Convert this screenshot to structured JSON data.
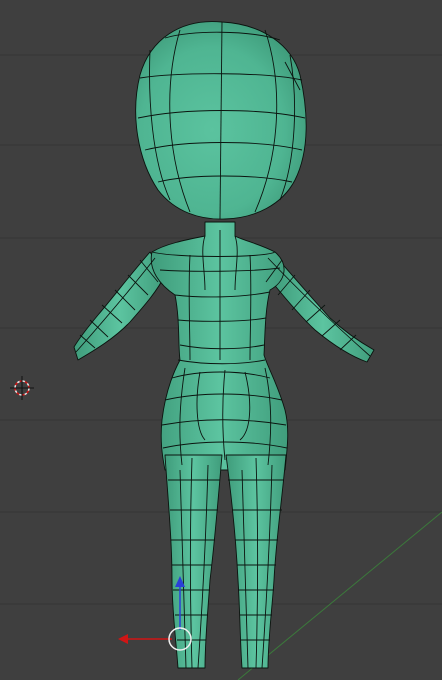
{
  "viewport": {
    "background": "#3f3f3f",
    "grid_color": "#363636",
    "mesh_fill": "#4fb592",
    "mesh_fill_shade": "#3f9c7b",
    "mesh_fill_light": "#62c7a4",
    "wire_color": "#0b140f"
  },
  "icons": {
    "cursor": "3d-cursor-icon",
    "gizmo_x": "x-axis-arrow-icon",
    "gizmo_z": "z-axis-arrow-icon",
    "gizmo_center": "transform-center-circle-icon"
  },
  "colors": {
    "x_axis": "#d01515",
    "z_axis": "#2a3fd8",
    "ground_line": "#3b7a3b"
  }
}
